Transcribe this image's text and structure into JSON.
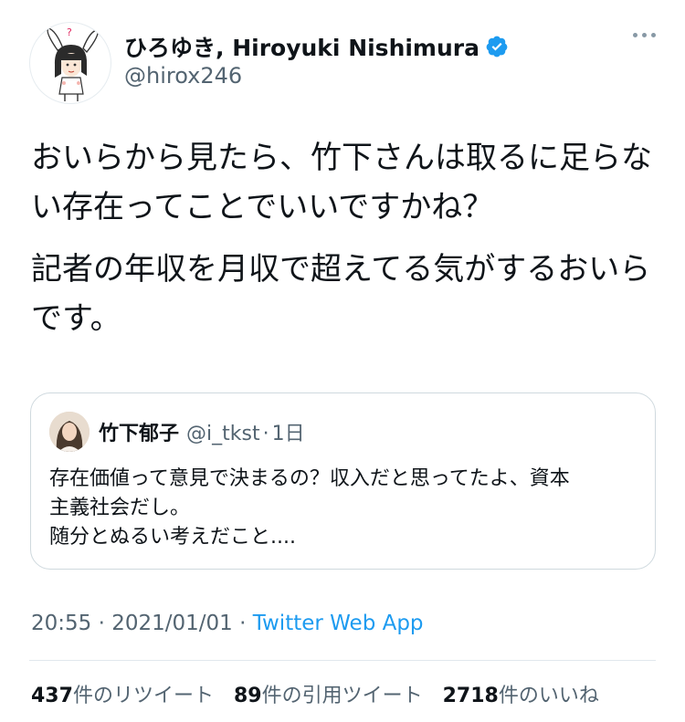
{
  "author": {
    "display_name": "ひろゆき, Hiroyuki Nishimura",
    "handle": "@hirox246",
    "verified_icon": "verified-badge-icon",
    "avatar_icon": "cartoon-avatar-icon"
  },
  "tweet": {
    "paragraphs": [
      "おいらから見たら、竹下さんは取るに足らない存在ってことでいいですかね？",
      "記者の年収を月収で超えてる気がするおいらです。"
    ]
  },
  "quote": {
    "name": "竹下郁子",
    "handle": "@i_tkst",
    "separator": "·",
    "time": "1日",
    "lines": [
      "存在価値って意見で決まるの？収入だと思ってたよ、資本",
      "主義社会だし。",
      "随分とぬるい考えだこと...."
    ]
  },
  "meta": {
    "time": "20:55",
    "sep1": " · ",
    "date": "2021/01/01",
    "sep2": " · ",
    "source": "Twitter Web App"
  },
  "stats": [
    {
      "num": "437",
      "label": "件のリツイート"
    },
    {
      "num": "89",
      "label": "件の引用ツイート"
    },
    {
      "num": "2718",
      "label": "件のいいね"
    }
  ],
  "colors": {
    "accent": "#1d9bf0",
    "text": "#0f1419",
    "secondary": "#536471",
    "border": "#cfd9de"
  }
}
